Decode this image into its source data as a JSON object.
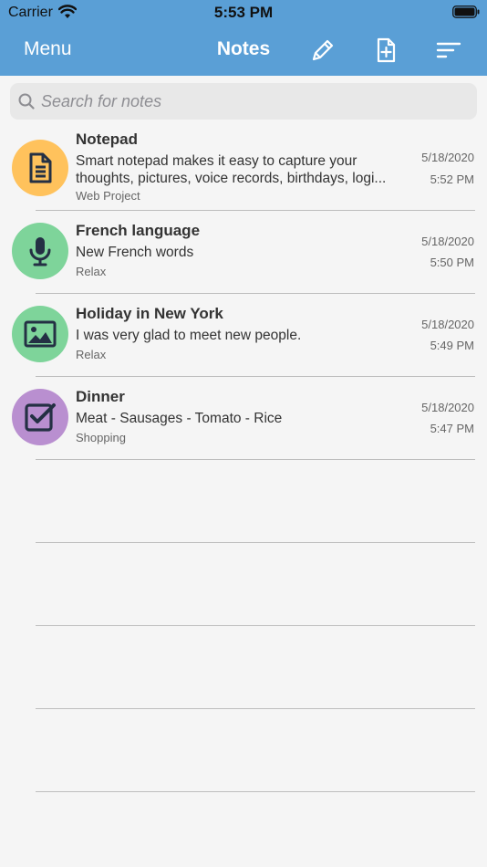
{
  "status_bar": {
    "carrier": "Carrier",
    "time": "5:53 PM"
  },
  "nav": {
    "menu_label": "Menu",
    "title": "Notes"
  },
  "search": {
    "placeholder": "Search for notes",
    "value": ""
  },
  "colors": {
    "header": "#5a9fd6",
    "avatar_orange": "#ffc25c",
    "avatar_green": "#7ed49a",
    "avatar_purple": "#b98fd0",
    "icon_dark": "#243044"
  },
  "notes": [
    {
      "icon": "document-icon",
      "color": "#ffc25c",
      "title": "Notepad",
      "body": "Smart notepad makes it easy to capture your thoughts, pictures, voice records, birthdays, logi...",
      "category": "Web Project",
      "date": "5/18/2020",
      "time": "5:52 PM"
    },
    {
      "icon": "microphone-icon",
      "color": "#7ed49a",
      "title": "French language",
      "body": "New French words",
      "category": "Relax",
      "date": "5/18/2020",
      "time": "5:50 PM"
    },
    {
      "icon": "image-icon",
      "color": "#7ed49a",
      "title": "Holiday in New York",
      "body": "I was very glad to meet new people.",
      "category": "Relax",
      "date": "5/18/2020",
      "time": "5:49 PM"
    },
    {
      "icon": "checkbox-icon",
      "color": "#b98fd0",
      "title": "Dinner",
      "body": "Meat - Sausages - Tomato - Rice",
      "category": "Shopping",
      "date": "5/18/2020",
      "time": "5:47 PM"
    }
  ]
}
